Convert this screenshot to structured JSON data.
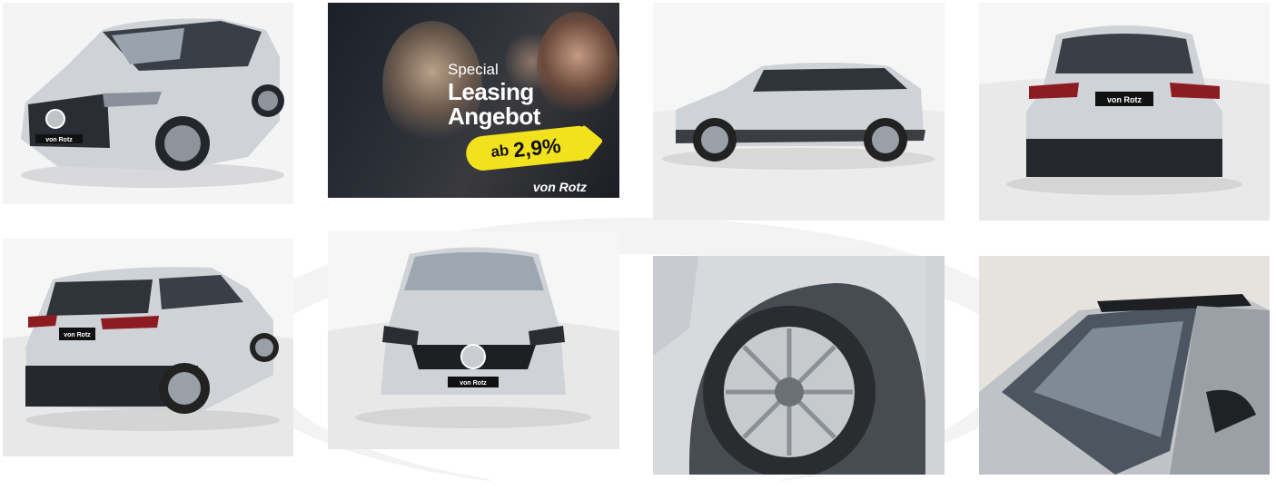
{
  "gallery": {
    "images": [
      {
        "alt": "Mercedes GLA front three-quarter view"
      },
      {
        "alt": "Special Leasing Angebot ab 2,9% promotion"
      },
      {
        "alt": "Mercedes GLA side profile view"
      },
      {
        "alt": "Mercedes GLA rear view"
      },
      {
        "alt": "Mercedes GLA rear three-quarter view"
      },
      {
        "alt": "Mercedes GLA front view"
      },
      {
        "alt": "Mercedes GLA wheel close-up"
      },
      {
        "alt": "Mercedes GLA panoramic roof and windshield"
      }
    ]
  },
  "promo": {
    "special": "Special",
    "leasing": "Leasing",
    "angebot": "Angebot",
    "ab": "ab",
    "rate": "2,9%",
    "brand": "von Rotz"
  },
  "plates": {
    "dealer_plate": "von Rotz"
  },
  "colors": {
    "badge_yellow": "#f2e21e",
    "car_silver": "#cfd2d6",
    "promo_dark": "#24282f"
  }
}
